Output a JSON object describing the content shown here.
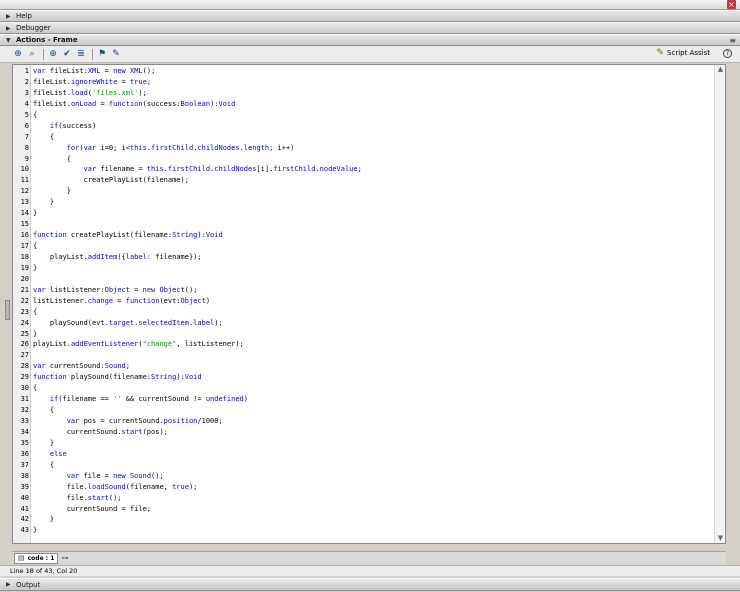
{
  "window": {
    "close_glyph": "×"
  },
  "panels": {
    "help": {
      "label": "Help"
    },
    "debugger": {
      "label": "Debugger"
    },
    "actions": {
      "label": "Actions - Frame",
      "options_glyph": "≡"
    },
    "output": {
      "label": "Output"
    }
  },
  "toolbar": {
    "buttons": [
      {
        "icon": "add-statement-icon",
        "glyph": "⊕"
      },
      {
        "icon": "find-icon",
        "glyph": "⌕"
      },
      {
        "icon": "target-path-icon",
        "glyph": "⊕"
      },
      {
        "icon": "check-syntax-icon",
        "glyph": "✔"
      },
      {
        "icon": "auto-format-icon",
        "glyph": "≣"
      },
      {
        "icon": "code-hint-icon",
        "glyph": "⚑"
      },
      {
        "icon": "debug-options-icon",
        "glyph": "✎"
      }
    ],
    "script_assist": {
      "label": "Script Assist",
      "glyph": "✎"
    },
    "help_glyph": "?"
  },
  "code_lines": [
    "<k>var</k> fileList:<k>XML</k> = <k>new</k> <k>XML</k>();",
    "fileList.<k>ignoreWhite</k> = <k>true</k>;",
    "fileList.<k>load</k>(<s>'files.xml'</s>);",
    "fileList.<k>onLoad</k> = <k>function</k>(success:<k>Boolean</k>):<k>Void</k>",
    "{",
    "    <k>if</k>(success)",
    "    {",
    "        <k>for</k>(<k>var</k> i=0; i&lt;<k>this</k>.<k>firstChild</k>.<k>childNodes</k>.<k>length</k>; i++)",
    "        {",
    "            <k>var</k> filename = <k>this</k>.<k>firstChild</k>.<k>childNodes</k>[i].<k>firstChild</k>.<k>nodeValue</k>;",
    "            createPlayList(filename);",
    "        }",
    "    }",
    "}",
    "",
    "<k>function</k> createPlayList(filename:<k>String</k>):<k>Void</k>",
    "{",
    "    playList.<k>addItem</k>({<k>label</k>: filename});",
    "}",
    "",
    "<k>var</k> listListener:<k>Object</k> = <k>new</k> <k>Object</k>();",
    "listListener.<k>change</k> = <k>function</k>(evt:<k>Object</k>)",
    "{",
    "    playSound(evt.<k>target</k>.<k>selectedItem</k>.<k>label</k>);",
    "}",
    "playList.<k>addEventListener</k>(<s>\"change\"</s>, listListener);",
    "",
    "<k>var</k> currentSound:<k>Sound</k>;",
    "<k>function</k> playSound(filename:<k>String</k>):<k>Void</k>",
    "{",
    "    <k>if</k>(filename == <s>''</s> &amp;&amp; currentSound != <k>undefined</k>)",
    "    {",
    "        <k>var</k> pos = currentSound.<k>position</k>/1000;",
    "        currentSound.<k>start</k>(pos);",
    "    }",
    "    <k>else</k>",
    "    {",
    "        <k>var</k> file = <k>new</k> <k>Sound</k>();",
    "        file.<k>loadSound</k>(filename, <k>true</k>);",
    "        file.<k>start</k>();",
    "        currentSound = file;",
    "    }",
    "}"
  ],
  "script_tab": {
    "label": "code : 1",
    "icon": "script-tab-icon",
    "pin_icon": "pin-icon"
  },
  "status": {
    "text": "Line 18 of 43, Col 20"
  },
  "colors": {
    "keyword": "#0000ff",
    "string": "#009900"
  }
}
